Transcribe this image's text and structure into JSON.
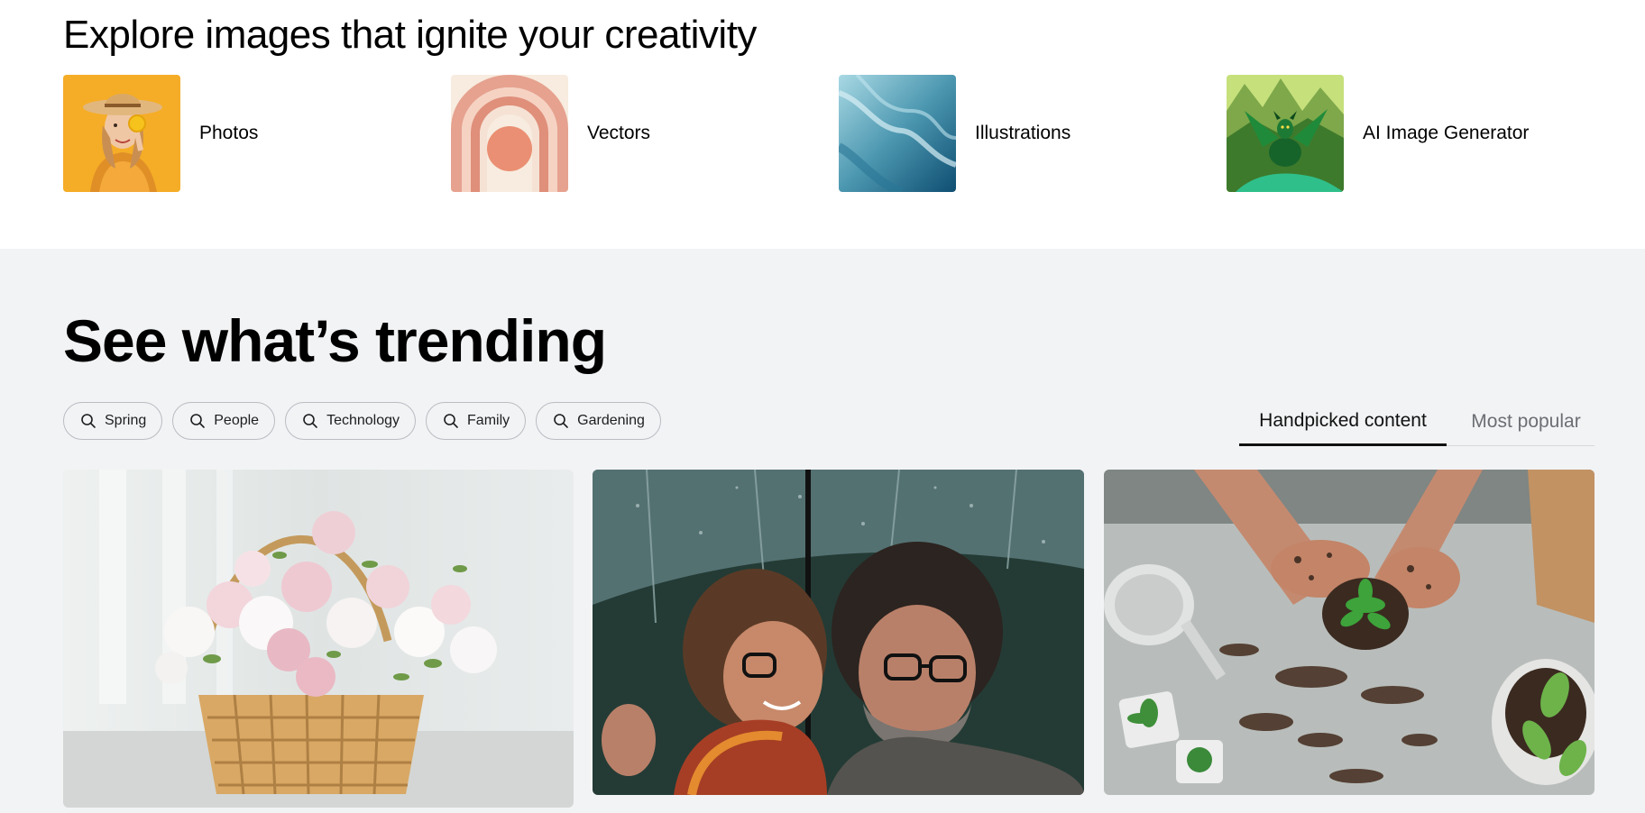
{
  "explore": {
    "title": "Explore images that ignite your creativity",
    "categories": [
      {
        "label": "Photos",
        "icon": "woman-with-hat-photo"
      },
      {
        "label": "Vectors",
        "icon": "rainbow-arch-vector"
      },
      {
        "label": "Illustrations",
        "icon": "blue-water-illustration"
      },
      {
        "label": "AI Image Generator",
        "icon": "green-dragon-ai-image"
      }
    ]
  },
  "trending": {
    "title": "See what’s trending",
    "chips": [
      "Spring",
      "People",
      "Technology",
      "Family",
      "Gardening"
    ],
    "tabs": [
      {
        "label": "Handpicked content",
        "active": true
      },
      {
        "label": "Most popular",
        "active": false
      }
    ],
    "photos": [
      "flower-basket-photo",
      "couple-under-umbrella-photo",
      "gardening-hands-photo"
    ]
  },
  "colors": {
    "trending_bg": "#f2f3f5",
    "chip_border": "#b9bcc1",
    "tab_inactive": "#6b6e73",
    "text": "#000000"
  }
}
